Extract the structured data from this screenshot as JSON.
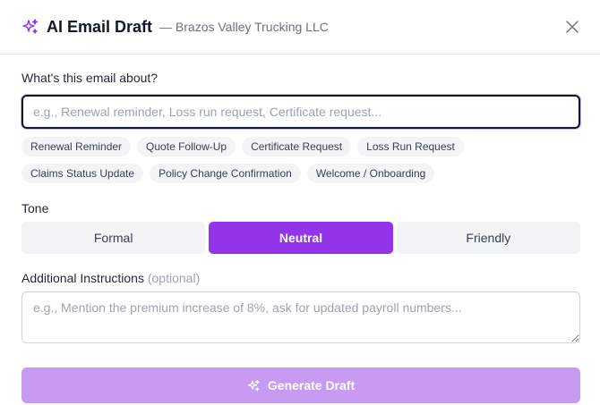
{
  "header": {
    "title": "AI Email Draft",
    "subtitle": "— Brazos Valley Trucking LLC",
    "sparkle_icon": "sparkle-icon",
    "close_icon": "close-icon"
  },
  "subject": {
    "label": "What's this email about?",
    "value": "",
    "placeholder": "e.g., Renewal reminder, Loss run request, Certificate request..."
  },
  "suggestions": [
    "Renewal Reminder",
    "Quote Follow-Up",
    "Certificate Request",
    "Loss Run Request",
    "Claims Status Update",
    "Policy Change Confirmation",
    "Welcome / Onboarding"
  ],
  "tone": {
    "label": "Tone",
    "options": [
      "Formal",
      "Neutral",
      "Friendly"
    ],
    "selected": "Neutral"
  },
  "instructions": {
    "label": "Additional Instructions",
    "optional_label": "(optional)",
    "value": "",
    "placeholder": "e.g., Mention the premium increase of 8%, ask for updated payroll numbers..."
  },
  "generate": {
    "label": "Generate Draft",
    "icon": "sparkle-icon"
  },
  "colors": {
    "accent": "#9333ea",
    "accent_disabled": "#c89af2"
  }
}
